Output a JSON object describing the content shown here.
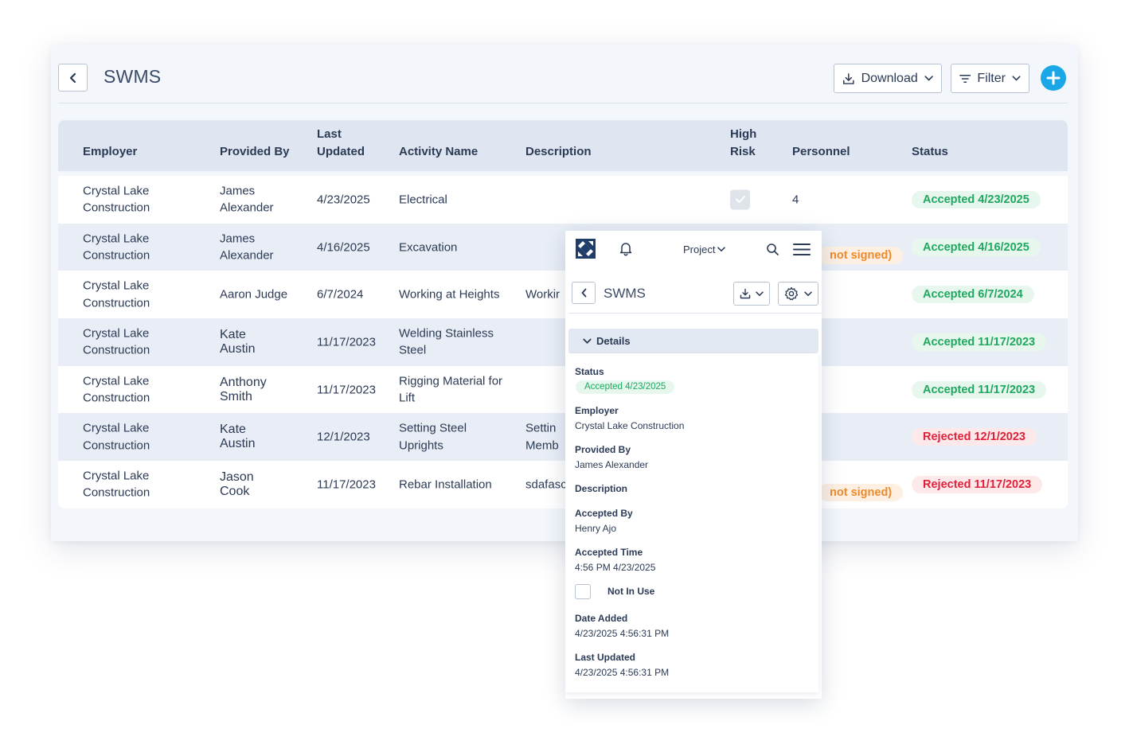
{
  "desktop": {
    "title": "SWMS",
    "download_label": "Download",
    "filter_label": "Filter",
    "columns": {
      "employer": "Employer",
      "provided_by": "Provided By",
      "last_updated_1": "Last",
      "last_updated_2": "Updated",
      "activity_name": "Activity Name",
      "description": "Description",
      "high_risk_1": "High",
      "high_risk_2": "Risk",
      "personnel": "Personnel",
      "status": "Status"
    },
    "rows": [
      {
        "employer_1": "Crystal Lake",
        "employer_2": "Construction",
        "provided_1": "James",
        "provided_2": "Alexander",
        "updated": "4/23/2025",
        "activity_1": "Electrical",
        "activity_2": "",
        "description": "",
        "personnel": "4",
        "status": "Accepted 4/23/2025"
      },
      {
        "employer_1": "Crystal Lake",
        "employer_2": "Construction",
        "provided_1": "James",
        "provided_2": "Alexander",
        "updated": "4/16/2025",
        "activity_1": "Excavation",
        "activity_2": "",
        "description": "",
        "personnel": "",
        "status": "Accepted 4/16/2025",
        "pending": "not signed)"
      },
      {
        "employer_1": "Crystal Lake",
        "employer_2": "Construction",
        "provided_1": "Aaron Judge",
        "provided_2": "",
        "updated": "6/7/2024",
        "activity_1": "Working at Heights",
        "activity_2": "",
        "description": "Workir",
        "personnel": "",
        "status": "Accepted 6/7/2024"
      },
      {
        "employer_1": "Crystal Lake",
        "employer_2": "Construction",
        "provided_1": "Kate",
        "provided_2": "Austin",
        "updated": "11/17/2023",
        "activity_1": "Welding Stainless",
        "activity_2": "Steel",
        "description": "",
        "personnel": "",
        "status": "Accepted 11/17/2023"
      },
      {
        "employer_1": "Crystal Lake",
        "employer_2": "Construction",
        "provided_1": "Anthony",
        "provided_2": "Smith",
        "updated": "11/17/2023",
        "activity_1": "Rigging Material for",
        "activity_2": "Lift",
        "description": "",
        "personnel": "",
        "status": "Accepted 11/17/2023"
      },
      {
        "employer_1": "Crystal Lake",
        "employer_2": "Construction",
        "provided_1": "Kate",
        "provided_2": "Austin",
        "updated": "12/1/2023",
        "activity_1": "Setting Steel",
        "activity_2": "Uprights",
        "description": "Settin",
        "description_2": "Memb",
        "personnel": "",
        "status": "Rejected 12/1/2023"
      },
      {
        "employer_1": "Crystal Lake",
        "employer_2": "Construction",
        "provided_1": "Jason",
        "provided_2": "Cook",
        "updated": "11/17/2023",
        "activity_1": "Rebar Installation",
        "activity_2": "",
        "description": "sdafasc",
        "personnel": "",
        "status": "Rejected 11/17/2023",
        "pending": "not signed)"
      }
    ]
  },
  "mobile": {
    "project_label": "Project",
    "title": "SWMS",
    "details_label": "Details",
    "status_label": "Status",
    "status_value": "Accepted 4/23/2025",
    "employer_label": "Employer",
    "employer_value": "Crystal Lake Construction",
    "provided_label": "Provided By",
    "provided_value": "James Alexander",
    "description_label": "Description",
    "accepted_by_label": "Accepted By",
    "accepted_by_value": "Henry Ajo",
    "accepted_time_label": "Accepted Time",
    "accepted_time_value": "4:56 PM 4/23/2025",
    "not_in_use_label": "Not In Use",
    "date_added_label": "Date Added",
    "date_added_value": "4/23/2025 4:56:31 PM",
    "last_updated_label": "Last Updated",
    "last_updated_value": "4/23/2025 4:56:31 PM"
  },
  "colors": {
    "accent": "#1aa7e8",
    "accepted": "#1fa85f",
    "rejected": "#e0213a",
    "pending": "#ef8a2a"
  }
}
